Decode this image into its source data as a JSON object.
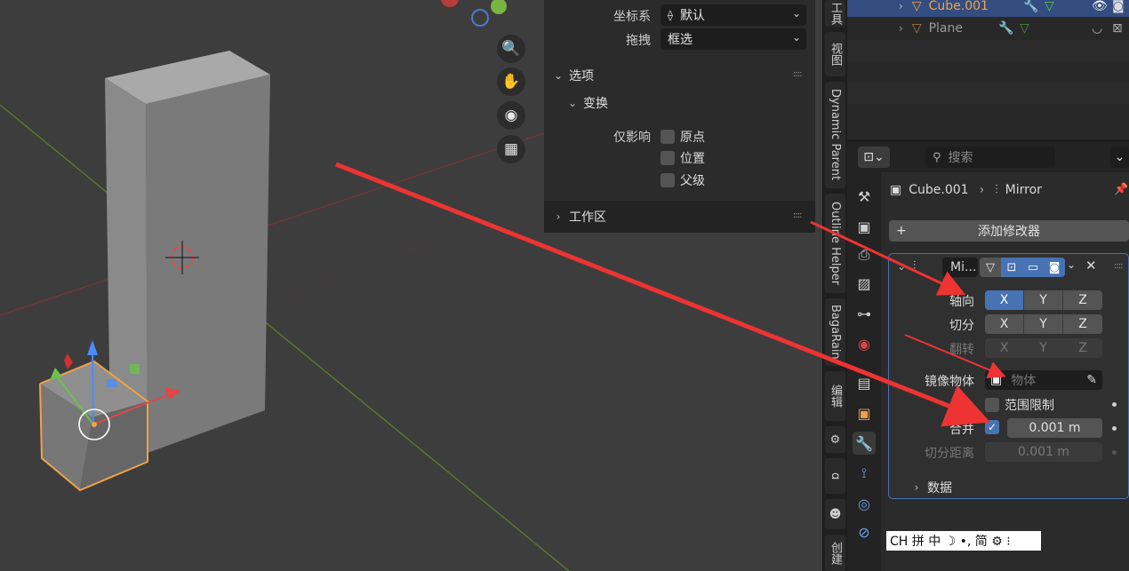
{
  "viewport": {
    "nav_buttons": [
      "zoom-icon",
      "hand-pan-icon",
      "camera-icon",
      "grid-ortho-icon"
    ]
  },
  "npanel": {
    "coord_label": "坐标系",
    "coord_value": "默认",
    "drag_label": "拖拽",
    "drag_value": "框选",
    "options_title": "选项",
    "transform_title": "变换",
    "affect_only_label": "仅影响",
    "affect_origin": "原点",
    "affect_location": "位置",
    "affect_parents": "父级",
    "workspace_title": "工作区"
  },
  "vtabs": [
    "工具",
    "视图",
    "Dynamic Parent",
    "Outline Helper",
    "BagaRain",
    "编辑",
    "",
    "",
    "",
    "创建"
  ],
  "outliner": {
    "rows": [
      {
        "name": "Cube.001",
        "selected": true
      },
      {
        "name": "Plane",
        "selected": false
      }
    ]
  },
  "props": {
    "search_placeholder": "搜索",
    "breadcrumb_object": "Cube.001",
    "breadcrumb_modifier": "Mirror",
    "add_modifier": "添加修改器",
    "modifier_name": "Mi...",
    "axis_label": "轴向",
    "bisect_label": "切分",
    "flip_label": "翻转",
    "axes": [
      "X",
      "Y",
      "Z"
    ],
    "mirror_object_label": "镜像物体",
    "mirror_object_placeholder": "物体",
    "clipping_label": "范围限制",
    "merge_label": "合并",
    "merge_value": "0.001 m",
    "bisect_distance_label": "切分距离",
    "bisect_distance_value": "0.001 m",
    "data_section": "数据"
  },
  "ime": {
    "text": "CH 拼 中 ☽ •, 简 ⚙ ⁝"
  },
  "colors": {
    "accent_blue": "#4772b3",
    "selected_orange": "#f0a24a",
    "annotation_red": "#ee3333"
  }
}
